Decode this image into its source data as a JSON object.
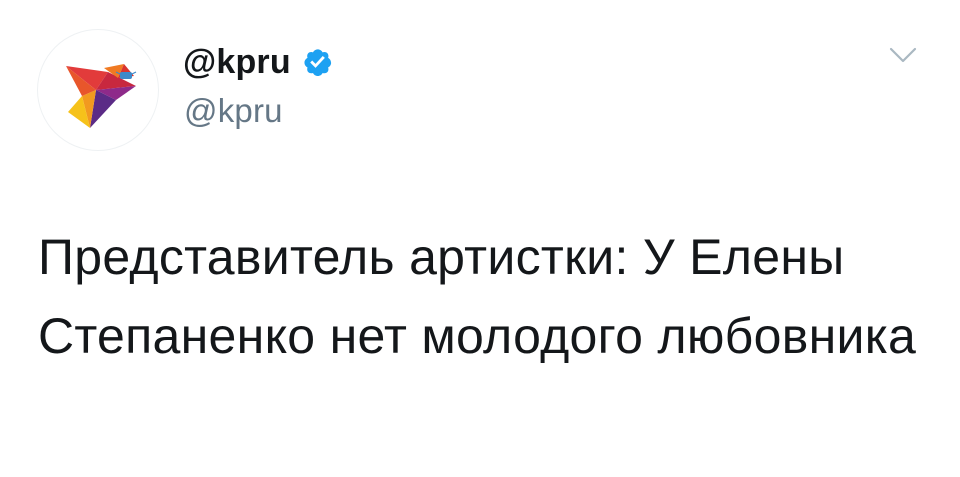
{
  "account": {
    "display_name": "@kpru",
    "handle": "@kpru",
    "verified": true,
    "avatar_icon": "kp-swallow-logo-icon",
    "verified_icon": "verified-badge-icon"
  },
  "menu": {
    "icon": "chevron-down-icon"
  },
  "tweet": {
    "text": "Представитель артистки: У Елены Степаненко нет молодого любовника"
  },
  "colors": {
    "text_primary": "#14171a",
    "text_secondary": "#657786",
    "verified_blue": "#1da1f2",
    "caret_gray": "#aab8c2"
  }
}
